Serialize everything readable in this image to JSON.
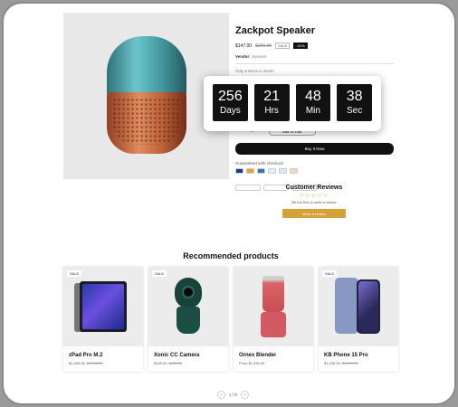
{
  "product": {
    "title": "Zackpot Speaker",
    "price": "$147.00",
    "compare_price": "$299.00",
    "sale_tag": "SALE",
    "off_tag": "-51%",
    "vendor_label": "Vendor:",
    "vendor_value": "Speaker",
    "stock": "Only 6 items in stock!",
    "hurry": "Hurry up! Sale ends In",
    "qty_minus": "−",
    "qty_value": "1",
    "qty_plus": "+",
    "add_to_cart": "Add To Cart",
    "buy_now": "Buy It Now",
    "checkout_label": "Guaranteed safe checkout"
  },
  "countdown": [
    {
      "value": "256",
      "label": "Days"
    },
    {
      "value": "21",
      "label": "Hrs"
    },
    {
      "value": "48",
      "label": "Min"
    },
    {
      "value": "38",
      "label": "Sec"
    }
  ],
  "reviews": {
    "title": "Customer Reviews",
    "stars": "☆☆☆☆☆",
    "first": "Be the first to write a review",
    "write": "Write a review"
  },
  "recommended": {
    "title": "Recommended products",
    "products": [
      {
        "name": "zPad Pro M.2",
        "price": "$1,400.00",
        "compare": "$2,000.00",
        "sale": "SALE"
      },
      {
        "name": "Xonic CC Camera",
        "price": "$159.00",
        "compare": "$499.00",
        "sale": "SALE"
      },
      {
        "name": "Ornex Blender",
        "price": "From $1,030.00",
        "compare": "",
        "sale": ""
      },
      {
        "name": "KB Phone 15 Pro",
        "price": "$1,199.00",
        "compare": "$1,500.00",
        "sale": "SALE"
      }
    ]
  },
  "pager": {
    "prev": "‹",
    "text": "1 / 8",
    "next": "›"
  }
}
